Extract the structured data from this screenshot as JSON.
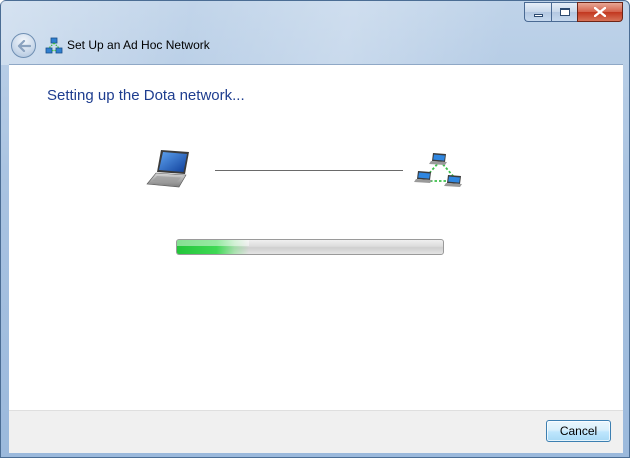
{
  "window": {
    "title": "Set Up an Ad Hoc Network",
    "caption_buttons": [
      "minimize",
      "maximize",
      "close"
    ]
  },
  "navbar": {
    "back_icon": "back-arrow-icon",
    "app_icon": "adhoc-network-icon"
  },
  "main": {
    "heading": "Setting up the Dota network...",
    "source_icon": "laptop-icon",
    "target_icon": "adhoc-network-icon",
    "progress": {
      "value_fraction": 0.27,
      "accent_color": "#23c53a"
    }
  },
  "footer": {
    "cancel_label": "Cancel"
  },
  "colors": {
    "heading": "#1e3d8f",
    "frame": "#a9c3e1",
    "close_button": "#c2371f"
  }
}
